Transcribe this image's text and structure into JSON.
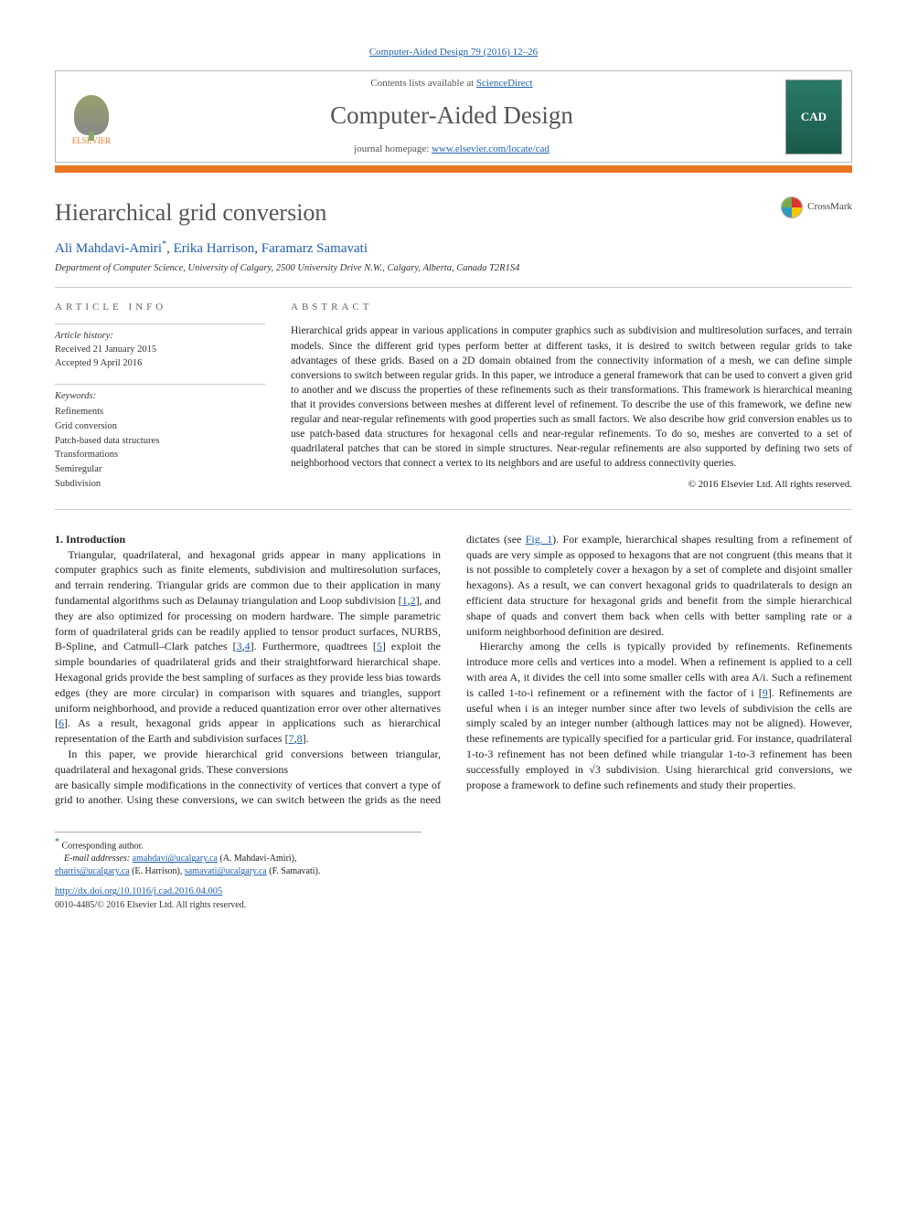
{
  "top_citation": {
    "pre": "",
    "link": "Computer-Aided Design 79 (2016) 12–26"
  },
  "header": {
    "contents_pre": "Contents lists available at ",
    "contents_link": "ScienceDirect",
    "journal": "Computer-Aided Design",
    "homepage_pre": "journal homepage: ",
    "homepage_link": "www.elsevier.com/locate/cad",
    "publisher_label": "ELSEVIER",
    "cover_label": "CAD"
  },
  "crossmark": "CrossMark",
  "title": "Hierarchical grid conversion",
  "authors": {
    "a1": "Ali Mahdavi-Amiri",
    "a1sup": "*",
    "sep1": ", ",
    "a2": "Erika Harrison",
    "sep2": ", ",
    "a3": "Faramarz Samavati"
  },
  "affiliation": "Department of Computer Science, University of Calgary, 2500 University Drive N.W., Calgary, Alberta, Canada T2R1S4",
  "info": {
    "heading": "ARTICLE INFO",
    "history_label": "Article history:",
    "received": "Received 21 January 2015",
    "accepted": "Accepted 9 April 2016",
    "keywords_label": "Keywords:",
    "keywords": [
      "Refinements",
      "Grid conversion",
      "Patch-based data structures",
      "Transformations",
      "Semiregular",
      "Subdivision"
    ]
  },
  "abstract": {
    "heading": "ABSTRACT",
    "body": "Hierarchical grids appear in various applications in computer graphics such as subdivision and multiresolution surfaces, and terrain models. Since the different grid types perform better at different tasks, it is desired to switch between regular grids to take advantages of these grids. Based on a 2D domain obtained from the connectivity information of a mesh, we can define simple conversions to switch between regular grids. In this paper, we introduce a general framework that can be used to convert a given grid to another and we discuss the properties of these refinements such as their transformations. This framework is hierarchical meaning that it provides conversions between meshes at different level of refinement. To describe the use of this framework, we define new regular and near-regular refinements with good properties such as small factors. We also describe how grid conversion enables us to use patch-based data structures for hexagonal cells and near-regular refinements. To do so, meshes are converted to a set of quadrilateral patches that can be stored in simple structures. Near-regular refinements are also supported by defining two sets of neighborhood vectors that connect a vertex to its neighbors and are useful to address connectivity queries.",
    "copyright": "© 2016 Elsevier Ltd. All rights reserved."
  },
  "section1": {
    "heading": "1. Introduction",
    "p1a": "Triangular, quadrilateral, and hexagonal grids appear in many applications in computer graphics such as finite elements, subdivision and multiresolution surfaces, and terrain rendering. Triangular grids are common due to their application in many fundamental algorithms such as Delaunay triangulation and Loop subdivision [",
    "r1": "1",
    "rc1": ",",
    "r2": "2",
    "p1b": "], and they are also optimized for processing on modern hardware. The simple parametric form of quadrilateral grids can be readily applied to tensor product surfaces, NURBS, B-Spline, and Catmull–Clark patches [",
    "r3": "3",
    "rc2": ",",
    "r4": "4",
    "p1c": "]. Furthermore, quadtrees [",
    "r5": "5",
    "p1d": "] exploit the simple boundaries of quadrilateral grids and their straightforward hierarchical shape. Hexagonal grids provide the best sampling of surfaces as they provide less bias towards edges (they are more circular) in comparison with squares and triangles, support uniform neighborhood, and provide a reduced quantization error over other alternatives [",
    "r6": "6",
    "p1e": "]. As a result, hexagonal grids appear in applications such as hierarchical representation of the Earth and subdivision surfaces [",
    "r7": "7",
    "rc3": ",",
    "r8": "8",
    "p1f": "].",
    "p2": "In this paper, we provide hierarchical grid conversions between triangular, quadrilateral and hexagonal grids. These conversions",
    "p3a": "are basically simple modifications in the connectivity of vertices that convert a type of grid to another. Using these conversions, we can switch between the grids as the need dictates (see ",
    "fig1": "Fig. 1",
    "p3b": "). For example, hierarchical shapes resulting from a refinement of quads are very simple as opposed to hexagons that are not congruent (this means that it is not possible to completely cover a hexagon by a set of complete and disjoint smaller hexagons). As a result, we can convert hexagonal grids to quadrilaterals to design an efficient data structure for hexagonal grids and benefit from the simple hierarchical shape of quads and convert them back when cells with better sampling rate or a uniform neighborhood definition are desired.",
    "p4a": "Hierarchy among the cells is typically provided by refinements. Refinements introduce more cells and vertices into a model. When a refinement is applied to a cell with area A, it divides the cell into some smaller cells with area A/i. Such a refinement is called 1-to-i refinement or a refinement with the factor of i [",
    "r9": "9",
    "p4b": "]. Refinements are useful when i is an integer number since after two levels of subdivision the cells are simply scaled by an integer number (although lattices may not be aligned). However, these refinements are typically specified for a particular grid. For instance, quadrilateral 1-to-3 refinement has not been defined while triangular 1-to-3 refinement has been successfully employed in √3 subdivision. Using hierarchical grid conversions, we propose a framework to define such refinements and study their properties."
  },
  "footnotes": {
    "corr": "Corresponding author.",
    "emails_label": "E-mail addresses:",
    "e1": "amahdavi@ucalgary.ca",
    "n1": " (A. Mahdavi-Amiri),",
    "e2": "eharris@ucalgary.ca",
    "n2": " (E. Harrison), ",
    "e3": "samavati@ucalgary.ca",
    "n3": " (F. Samavati)."
  },
  "doi": {
    "link": "http://dx.doi.org/10.1016/j.cad.2016.04.005",
    "rights": "0010-4485/© 2016 Elsevier Ltd. All rights reserved."
  }
}
